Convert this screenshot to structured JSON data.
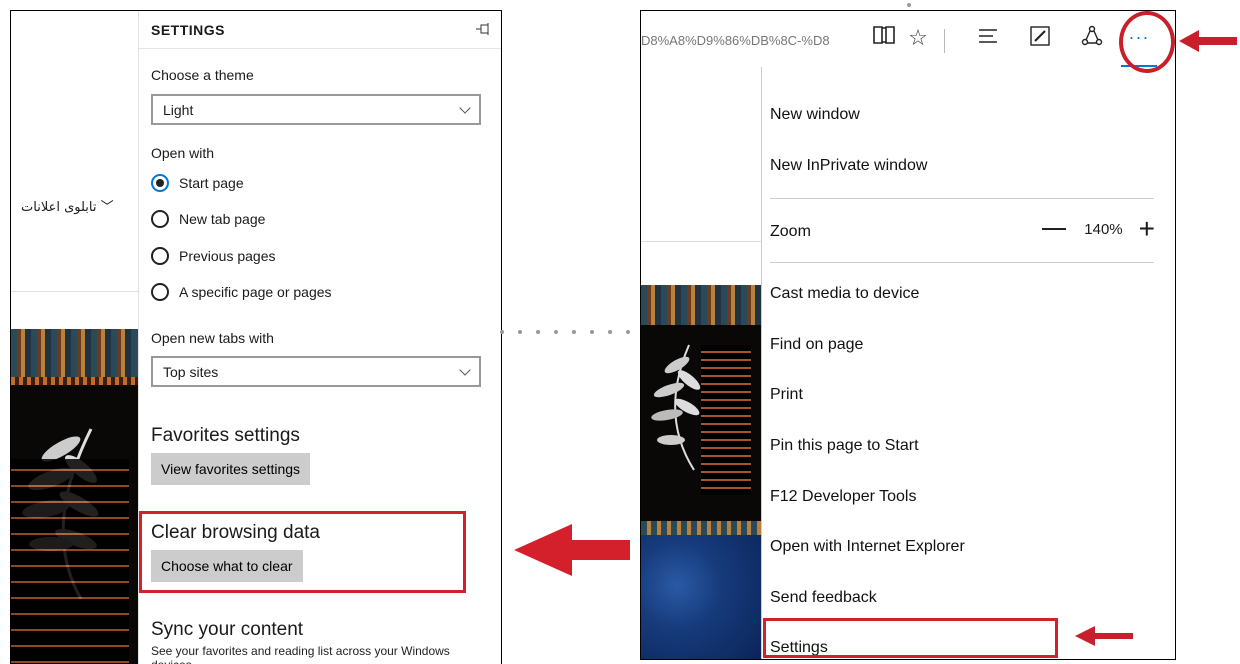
{
  "left_page": {
    "menu_label": "تابلوی اعلانات",
    "chevron_glyph": "⌵"
  },
  "settings": {
    "title": "SETTINGS",
    "pin_glyph": "⊣⊨",
    "theme_label": "Choose a theme",
    "theme_value": "Light",
    "open_with_label": "Open with",
    "open_with_options": [
      "Start page",
      "New tab page",
      "Previous pages",
      "A specific page or pages"
    ],
    "open_with_selected": "Start page",
    "new_tabs_label": "Open new tabs with",
    "new_tabs_value": "Top sites",
    "favorites_heading": "Favorites settings",
    "favorites_button": "View favorites settings",
    "clear_heading": "Clear browsing data",
    "clear_button": "Choose what to clear",
    "sync_heading": "Sync your content",
    "sync_description": "See your favorites and reading list across your Windows devices."
  },
  "toolbar": {
    "url_fragment": "D8%A8%D9%86%DB%8C-%D8",
    "more_glyph": "···"
  },
  "menu": {
    "new_window": "New window",
    "new_inprivate": "New InPrivate window",
    "zoom_label": "Zoom",
    "zoom_value": "140%",
    "cast": "Cast media to device",
    "find": "Find on page",
    "print": "Print",
    "pin": "Pin this page to Start",
    "devtools": "F12 Developer Tools",
    "open_ie": "Open with Internet Explorer",
    "feedback": "Send feedback",
    "settings": "Settings"
  },
  "colors": {
    "highlight_red": "#d4202b",
    "accent_blue": "#0078d7"
  }
}
